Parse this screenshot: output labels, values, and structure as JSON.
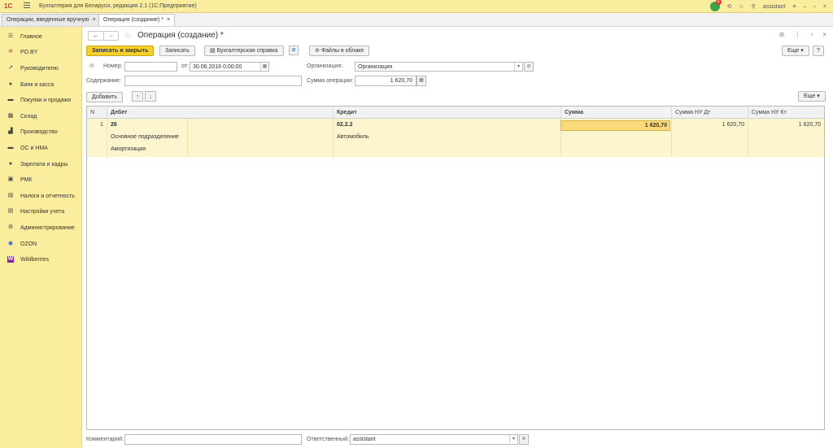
{
  "app": {
    "logo": "1С",
    "title": "Бухгалтерия для Беларуси, редакция 2.1 (1С:Предприятие)",
    "notifications": "1",
    "user": "assistant"
  },
  "tabs": [
    {
      "label": "Операции, введенные вручную",
      "close": "×"
    },
    {
      "label": "Операция (создание) *",
      "close": "×"
    }
  ],
  "sidebar": {
    "items": [
      {
        "label": "Главное",
        "icon": "☰"
      },
      {
        "label": "PO.BY",
        "icon": "✲"
      },
      {
        "label": "Руководителю",
        "icon": "↗"
      },
      {
        "label": "Банк и касса",
        "icon": "●"
      },
      {
        "label": "Покупки и продажи",
        "icon": "▬"
      },
      {
        "label": "Склад",
        "icon": "▦"
      },
      {
        "label": "Производство",
        "icon": "▟"
      },
      {
        "label": "ОС и НМА",
        "icon": "▬"
      },
      {
        "label": "Зарплата и кадры",
        "icon": "●"
      },
      {
        "label": "РМК",
        "icon": "▣"
      },
      {
        "label": "Налоги и отчетность",
        "icon": "▤"
      },
      {
        "label": "Настройки учета",
        "icon": "▤"
      },
      {
        "label": "Администрирование",
        "icon": "⚙"
      },
      {
        "label": "OZON",
        "icon": "◉"
      },
      {
        "label": "Wildberries",
        "icon": "W"
      }
    ]
  },
  "form": {
    "title": "Операция (создание) *",
    "buttons": {
      "save_close": "Записать и закрыть",
      "save": "Записать",
      "reference": "Бухгалтерская справка",
      "files": "Файлы в облаке",
      "more": "Еще",
      "help": "?"
    },
    "fields": {
      "number_label": "Номер:",
      "number_value": "",
      "date_label": "от:",
      "date_value": "30.06.2018  0:00:00",
      "org_label": "Организация:",
      "org_value": "Организация",
      "content_label": "Содержание:",
      "content_value": "",
      "sum_label": "Сумма операции:",
      "sum_value": "1 620,70"
    }
  },
  "table": {
    "add_label": "Добавить",
    "more": "Еще",
    "columns": [
      "N",
      "Дебет",
      "Кредит",
      "Сумма",
      "Сумма НУ Дт",
      "Сумма НУ Кт"
    ],
    "row": {
      "n": "1",
      "debit": "26",
      "debit_sub1": "Основное подразделение",
      "debit_sub2": "Амортизация",
      "credit": "02.2.2",
      "credit_sub1": "Автомобиль",
      "sum": "1 620,70",
      "sum_nu_dt": "1 620,70",
      "sum_nu_kt": "1 620,70"
    }
  },
  "footer": {
    "comment_label": "Комментарий:",
    "comment_value": "",
    "responsible_label": "Ответственный:",
    "responsible_value": "assistant"
  }
}
